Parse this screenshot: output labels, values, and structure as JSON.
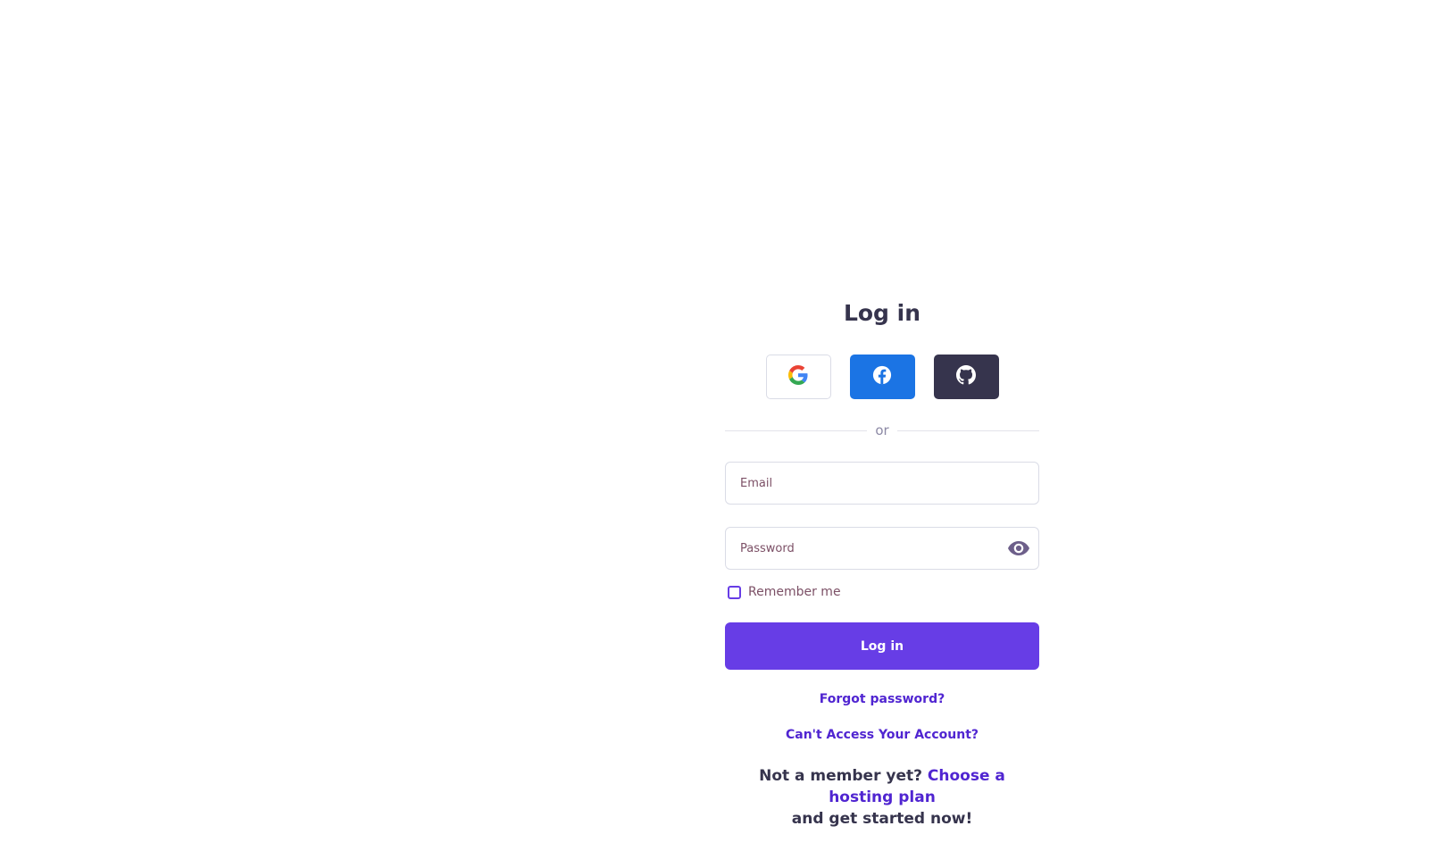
{
  "login": {
    "title": "Log in",
    "social": {
      "google": {
        "icon": "google-icon"
      },
      "facebook": {
        "icon": "facebook-icon",
        "color": "#1b74e4"
      },
      "github": {
        "icon": "github-icon",
        "color": "#36344d"
      }
    },
    "divider_text": "or",
    "email": {
      "placeholder": "Email",
      "value": ""
    },
    "password": {
      "placeholder": "Password",
      "value": "",
      "toggle_icon": "eye-icon"
    },
    "remember_me": {
      "label": "Remember me",
      "checked": false
    },
    "submit_label": "Log in",
    "forgot_password": "Forgot password?",
    "cant_access": "Can't Access Your Account?",
    "signup": {
      "prefix": "Not a member yet?",
      "link": "Choose a hosting plan",
      "suffix": "and get started now!"
    }
  },
  "colors": {
    "accent": "#673de6",
    "link": "#5025d1",
    "text": "#36344d",
    "facebook": "#1b74e4"
  }
}
